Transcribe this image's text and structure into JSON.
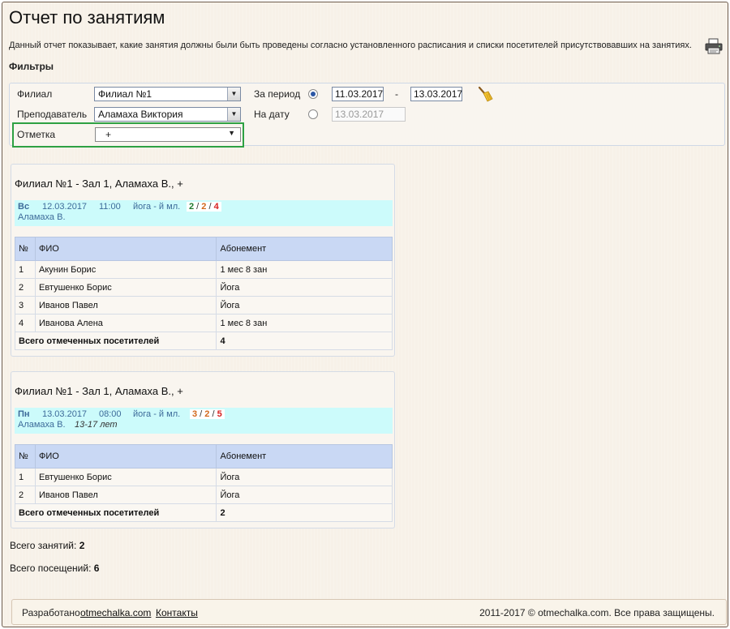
{
  "page": {
    "title": "Отчет по занятиям",
    "description": "Данный отчет показывает, какие занятия должны были быть проведены согласно установленного расписания и списки посетителей присутствовавших на занятиях."
  },
  "filters": {
    "heading": "Фильтры",
    "branch_label": "Филиал",
    "branch_value": "Филиал №1",
    "teacher_label": "Преподаватель",
    "teacher_value": "Аламаха Виктория",
    "mark_label": "Отметка",
    "mark_value": "+",
    "period_label": "За период",
    "period_from": "11.03.2017",
    "period_dash": "-",
    "period_to": "13.03.2017",
    "date_label": "На дату",
    "date_value": "13.03.2017"
  },
  "reports": [
    {
      "title": "Филиал №1 - Зал 1, Аламаха В., +",
      "day": "Вс",
      "date": "12.03.2017",
      "time": "11:00",
      "kind": "йога - й мл.",
      "count_a": "2",
      "count_b": "2",
      "count_c": "4",
      "teacher": "Аламаха В.",
      "age": "",
      "headers": [
        "№",
        "ФИО",
        "Абонемент"
      ],
      "rows": [
        {
          "n": "1",
          "name": "Акунин Борис",
          "sub": "1 мес 8 зан"
        },
        {
          "n": "2",
          "name": "Евтушенко Борис",
          "sub": "Йога"
        },
        {
          "n": "3",
          "name": "Иванов Павел",
          "sub": "Йога"
        },
        {
          "n": "4",
          "name": "Иванова Алена",
          "sub": "1 мес 8 зан"
        }
      ],
      "total_label": "Всего отмеченных посетителей",
      "total_value": "4"
    },
    {
      "title": "Филиал №1 - Зал 1, Аламаха В., +",
      "day": "Пн",
      "date": "13.03.2017",
      "time": "08:00",
      "kind": "йога - й мл.",
      "count_a": "3",
      "count_b": "2",
      "count_c": "5",
      "teacher": "Аламаха В.",
      "age": "13-17 лет",
      "headers": [
        "№",
        "ФИО",
        "Абонемент"
      ],
      "rows": [
        {
          "n": "1",
          "name": "Евтушенко Борис",
          "sub": "Йога"
        },
        {
          "n": "2",
          "name": "Иванов Павел",
          "sub": "Йога"
        }
      ],
      "total_label": "Всего отмеченных посетителей",
      "total_value": "2"
    }
  ],
  "summary": {
    "lessons_label": "Всего занятий:",
    "lessons_value": "2",
    "visits_label": "Всего посещений:",
    "visits_value": "6"
  },
  "footer": {
    "developed_label": "Разработано",
    "developed_link": "otmechalka.com",
    "contacts_link": "Контакты",
    "copyright": "2011-2017 © otmechalka.com. Все права защищены."
  },
  "icons": {
    "printer": "printer-icon",
    "clear": "broom-icon"
  }
}
